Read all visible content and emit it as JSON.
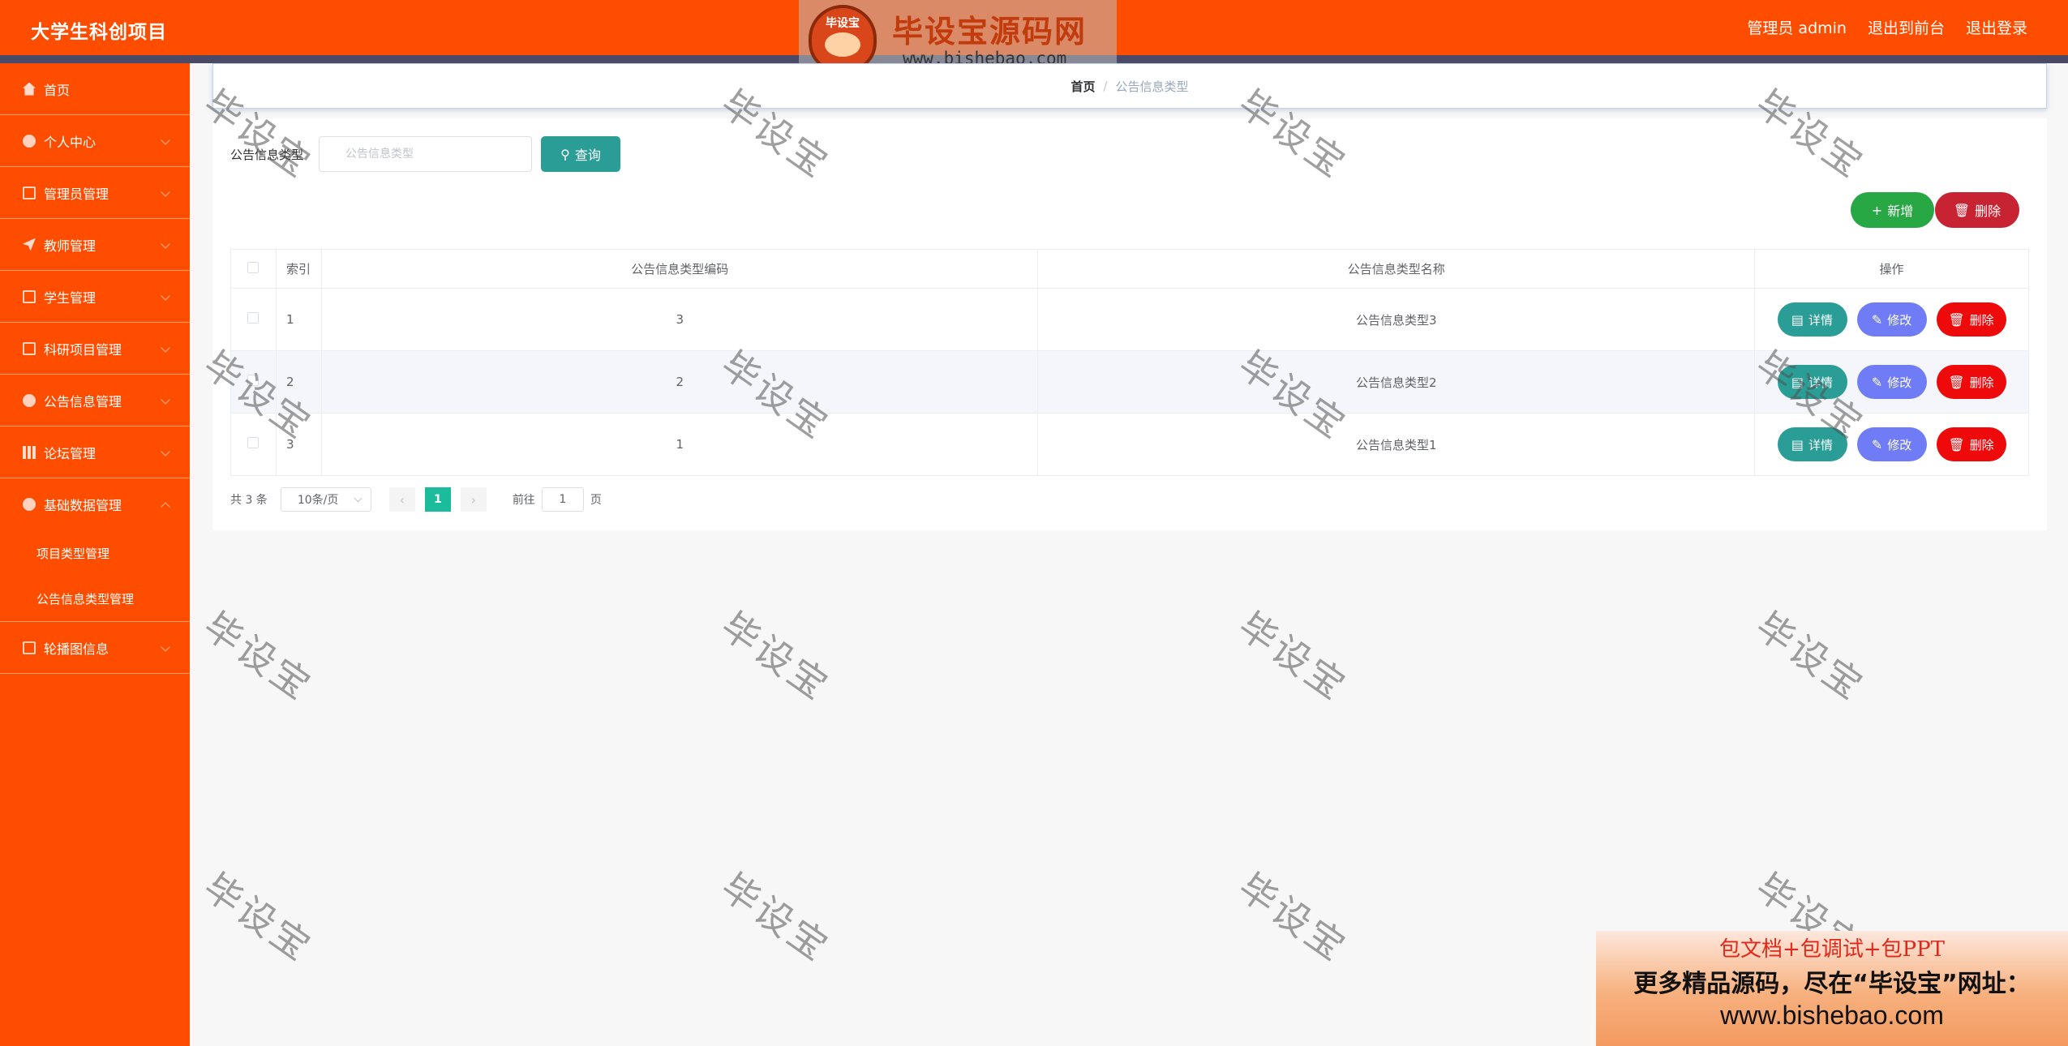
{
  "header": {
    "title": "大学生科创项目",
    "admin_label": "管理员 admin",
    "front_link": "退出到前台",
    "logout_link": "退出登录"
  },
  "logo_watermark": {
    "badge_text": "毕设宝",
    "name": "毕设宝源码网",
    "url": "www.bishebao.com"
  },
  "sidebar": {
    "items": [
      {
        "label": "首页",
        "icon": "home-icon"
      },
      {
        "label": "个人中心",
        "icon": "user-icon"
      },
      {
        "label": "管理员管理",
        "icon": "admin-icon"
      },
      {
        "label": "教师管理",
        "icon": "send-icon"
      },
      {
        "label": "学生管理",
        "icon": "monitor-icon"
      },
      {
        "label": "科研项目管理",
        "icon": "mail-icon"
      },
      {
        "label": "公告信息管理",
        "icon": "bulb-icon"
      },
      {
        "label": "论坛管理",
        "icon": "chart-icon"
      },
      {
        "label": "基础数据管理",
        "icon": "cloud-icon"
      },
      {
        "label": "轮播图信息",
        "icon": "crop-icon"
      }
    ],
    "submenu": [
      "项目类型管理",
      "公告信息类型管理"
    ]
  },
  "breadcrumb": {
    "home": "首页",
    "separator": "/",
    "current": "公告信息类型"
  },
  "search": {
    "label": "公告信息类型",
    "placeholder": "公告信息类型",
    "query_button": "查询"
  },
  "actions": {
    "add_button": "新增",
    "delete_button": "删除"
  },
  "table": {
    "headers": {
      "index": "索引",
      "code": "公告信息类型编码",
      "name": "公告信息类型名称",
      "op": "操作"
    },
    "rows": [
      {
        "index": "1",
        "code": "3",
        "name": "公告信息类型3"
      },
      {
        "index": "2",
        "code": "2",
        "name": "公告信息类型2"
      },
      {
        "index": "3",
        "code": "1",
        "name": "公告信息类型1"
      }
    ],
    "row_buttons": {
      "detail": "详情",
      "edit": "修改",
      "delete": "删除"
    }
  },
  "pagination": {
    "total": "共 3 条",
    "page_size": "10条/页",
    "prev": "‹",
    "current_page": "1",
    "next": "›",
    "goto_prefix": "前往",
    "goto_value": "1",
    "goto_suffix": "页"
  },
  "watermark_text": "毕设宝",
  "promo": {
    "line1": "包文档+包调试+包PPT",
    "line2": "更多精品源码，尽在“毕设宝”网址：",
    "line3": "www.bishebao.com"
  },
  "colors": {
    "brand": "#ff4d00",
    "teal": "#2a9d96",
    "green": "#28a745",
    "red": "#c82333",
    "edit": "#6f7cf5"
  }
}
